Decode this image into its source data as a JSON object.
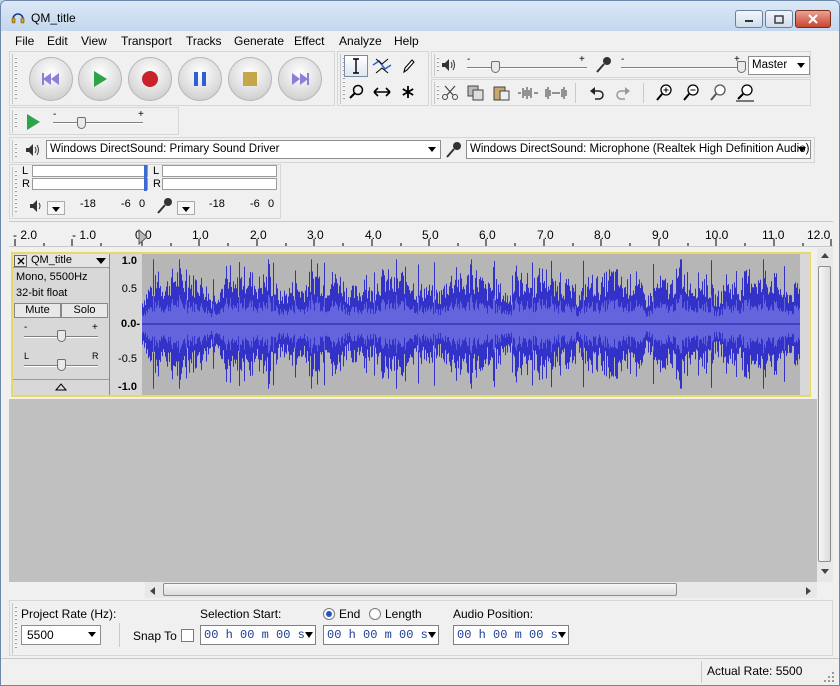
{
  "window": {
    "title": "QM_title"
  },
  "menu": [
    "File",
    "Edit",
    "View",
    "Transport",
    "Tracks",
    "Generate",
    "Effect",
    "Analyze",
    "Help"
  ],
  "mixer": {
    "output_device_master": "Master"
  },
  "devices": {
    "playback": "Windows DirectSound: Primary Sound Driver",
    "recording": "Windows DirectSound: Microphone (Realtek High Definition Audio)"
  },
  "meters": {
    "channel_left": "L",
    "channel_right": "R",
    "output_scale": [
      "-18",
      "-6",
      "0"
    ],
    "input_scale": [
      "-18",
      "-6",
      "0"
    ]
  },
  "ruler": [
    "- 2.0",
    "- 1.0",
    "0.0",
    "1.0",
    "2.0",
    "3.0",
    "4.0",
    "5.0",
    "6.0",
    "7.0",
    "8.0",
    "9.0",
    "10.0",
    "11.0",
    "12.0"
  ],
  "track": {
    "name": "QM_title",
    "info_line1": "Mono, 5500Hz",
    "info_line2": "32-bit float",
    "mute": "Mute",
    "solo": "Solo",
    "gain_minus": "-",
    "gain_plus": "+",
    "pan_left": "L",
    "pan_right": "R",
    "scale": [
      "1.0",
      "0.5",
      "0.0-",
      "-0.5",
      "-1.0"
    ]
  },
  "selection": {
    "project_rate_label": "Project Rate (Hz):",
    "project_rate": "5500",
    "snap_to": "Snap To",
    "selection_start_label": "Selection Start:",
    "end_label": "End",
    "length_label": "Length",
    "audio_position_label": "Audio Position:",
    "start_time": "00 h 00 m 00 s",
    "end_time": "00 h 00 m 00 s",
    "audio_time": "00 h 00 m 00 s",
    "end_selected": true
  },
  "status": {
    "actual_rate": "Actual Rate: 5500"
  },
  "colors": {
    "waveform": "#3232c8",
    "waveform_rms": "#6464dc",
    "track_border": "#e6d965"
  }
}
